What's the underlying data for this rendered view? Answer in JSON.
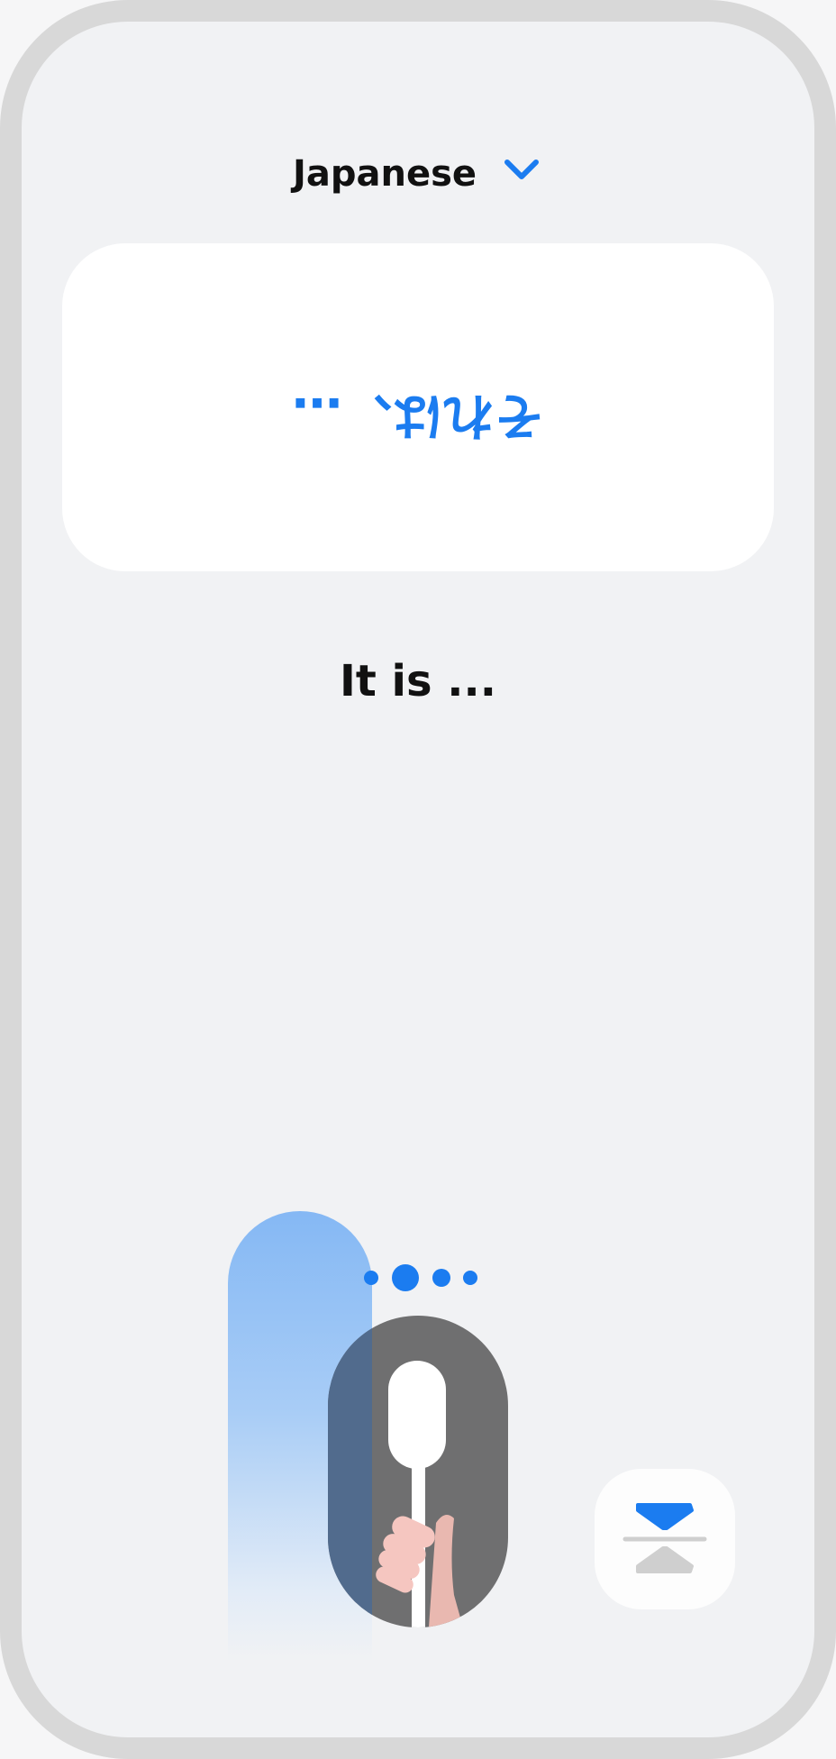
{
  "header": {
    "language": "Japanese",
    "dropdown_icon": "chevron-down-icon",
    "accent_color": "#1b7cf0"
  },
  "card": {
    "prompt_text": "それは、…"
  },
  "answer": {
    "text": "It is ..."
  },
  "progress_dots": {
    "count": 4,
    "active_index": 1
  },
  "mic": {
    "icon": "microphone-icon"
  },
  "fab": {
    "icon": "swap-direction-icon"
  }
}
